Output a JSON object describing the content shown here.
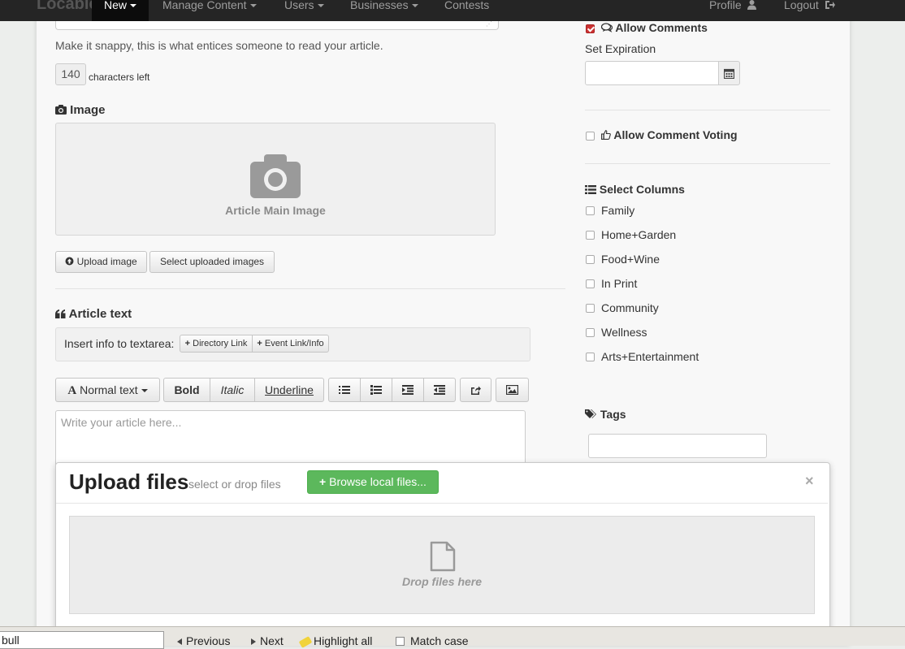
{
  "navbar": {
    "brand": "Locable",
    "items": [
      {
        "label": "New"
      },
      {
        "label": "Manage Content"
      },
      {
        "label": "Users"
      },
      {
        "label": "Businesses"
      },
      {
        "label": "Contests"
      }
    ],
    "profile": "Profile",
    "logout": "Logout"
  },
  "summary": {
    "help": "Make it snappy, this is what entices someone to read your article.",
    "count": "140",
    "count_suffix": "characters left"
  },
  "image_section": {
    "title": "Image",
    "placeholder_label": "Article Main Image",
    "upload_button": "Upload image",
    "select_button": "Select uploaded images"
  },
  "article_text": {
    "title": "Article text",
    "insert_label": "Insert info to textarea:",
    "directory_link": "Directory Link",
    "event_link": "Event Link/Info",
    "toolbar": {
      "normal_text": "Normal text",
      "bold": "Bold",
      "italic": "Italic",
      "underline": "Underline"
    },
    "placeholder": "Write your article here..."
  },
  "sidebar": {
    "allow_comments": {
      "label": "Allow Comments",
      "checked": true
    },
    "set_expiration": "Set Expiration",
    "allow_voting": {
      "label": "Allow Comment Voting",
      "checked": false
    },
    "columns_title": "Select Columns",
    "columns": [
      {
        "label": "Family"
      },
      {
        "label": "Home+Garden"
      },
      {
        "label": "Food+Wine"
      },
      {
        "label": "In Print"
      },
      {
        "label": "Community"
      },
      {
        "label": "Wellness"
      },
      {
        "label": "Arts+Entertainment"
      }
    ],
    "tags_title": "Tags"
  },
  "upload_modal": {
    "title": "Upload files",
    "subtitle": "select or drop files",
    "browse_button": "Browse local files...",
    "close": "×",
    "drop_label": "Drop files here"
  },
  "find_bar": {
    "query": "bull",
    "previous": "Previous",
    "next": "Next",
    "highlight_all": "Highlight all",
    "match_case": "Match case"
  },
  "colors": {
    "navbar": "#252525",
    "browse_button": "#5cb85c",
    "checked": "#cc3333"
  }
}
